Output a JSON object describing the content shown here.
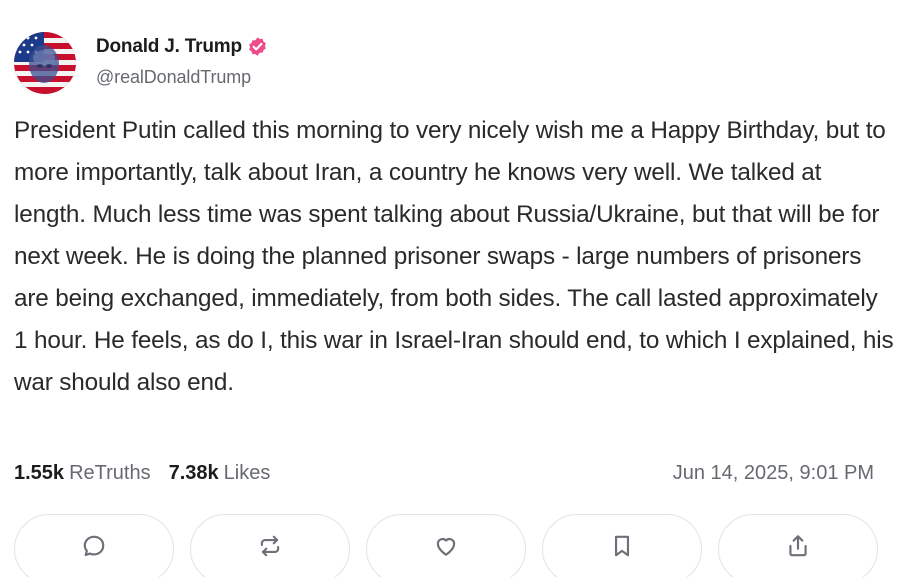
{
  "author": {
    "display_name": "Donald J. Trump",
    "handle": "@realDonaldTrump",
    "verified_color": "#ed4b8a",
    "avatar_icon": "flag-portrait-avatar"
  },
  "post": {
    "text": "President Putin called this morning to very nicely wish me a Happy Birthday, but to more importantly, talk about Iran, a country he knows very well. We talked at length. Much less time was spent talking about Russia/Ukraine, but that will be for next week. He is doing the planned prisoner swaps - large numbers of prisoners are being exchanged, immediately, from both sides. The call lasted approximately 1 hour. He feels, as do I, this war in Israel-Iran should end, to which I explained, his war should also end."
  },
  "stats": {
    "retruths_count": "1.55k",
    "retruths_label": "ReTruths",
    "likes_count": "7.38k",
    "likes_label": "Likes",
    "timestamp": "Jun 14, 2025, 9:01 PM"
  },
  "actions": [
    {
      "name": "reply",
      "icon": "comment-icon"
    },
    {
      "name": "retruth",
      "icon": "repost-icon"
    },
    {
      "name": "like",
      "icon": "heart-icon"
    },
    {
      "name": "bookmark",
      "icon": "bookmark-icon"
    },
    {
      "name": "share",
      "icon": "share-icon"
    }
  ],
  "colors": {
    "text": "#2a2a2a",
    "muted": "#666a70",
    "border": "#e1e3e6",
    "icon": "#6c7178"
  }
}
